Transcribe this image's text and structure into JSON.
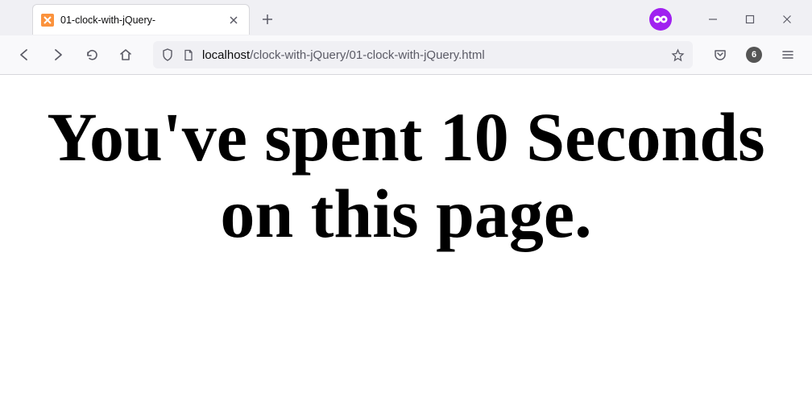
{
  "tab": {
    "title": "01-clock-with-jQuery-",
    "favicon_color": "#fb923c"
  },
  "url": {
    "domain": "localhost",
    "path": "/clock-with-jQuery/01-clock-with-jQuery.html"
  },
  "toolbar": {
    "notification_count": "6"
  },
  "page": {
    "heading": "You've spent 10 Seconds on this page."
  }
}
